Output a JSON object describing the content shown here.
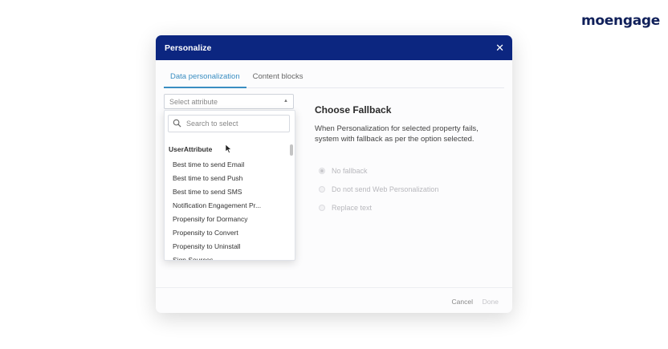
{
  "brand": {
    "name": "moengage"
  },
  "modal": {
    "title": "Personalize",
    "tabs": [
      {
        "label": "Data personalization",
        "active": true
      },
      {
        "label": "Content blocks",
        "active": false
      }
    ],
    "attribute_select": {
      "placeholder": "Select attribute"
    },
    "dropdown": {
      "search_placeholder": "Search to select",
      "group_label": "UserAttribute",
      "items": [
        "Best time to send Email",
        "Best time to send Push",
        "Best time to send SMS",
        "Notification Engagement Pr...",
        "Propensity for Dormancy",
        "Propensity to Convert",
        "Propensity to Uninstall",
        "Sign Sources"
      ]
    },
    "fallback": {
      "title": "Choose Fallback",
      "description": "When Personalization for selected property fails, system with fallback as per the option selected.",
      "options": [
        {
          "label": "No fallback",
          "selected": true
        },
        {
          "label": "Do not send Web Personalization",
          "selected": false
        },
        {
          "label": "Replace text",
          "selected": false
        }
      ]
    },
    "footer": {
      "cancel_label": "Cancel",
      "done_label": "Done"
    }
  },
  "colors": {
    "header_bg": "#0c2680",
    "accent": "#3a8ec2",
    "brand": "#10205a"
  }
}
